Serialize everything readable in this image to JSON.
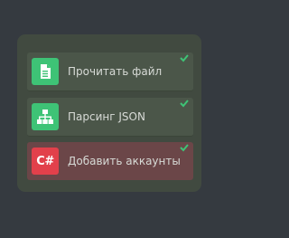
{
  "tasks": [
    {
      "label": "Прочитать файл",
      "icon": "file-icon",
      "status": "done",
      "icon_color": "#3ec376"
    },
    {
      "label": "Парсинг JSON",
      "icon": "sitemap-icon",
      "status": "done",
      "icon_color": "#3ec376"
    },
    {
      "label": "Добавить аккаунты",
      "icon": "csharp-icon",
      "icon_text": "C#",
      "status": "done",
      "icon_color": "#e2404b"
    }
  ],
  "colors": {
    "background": "#353a40",
    "panel": "#414a40",
    "item": "#4b5649",
    "item_active": "#6b4648",
    "check": "#3ec376"
  }
}
